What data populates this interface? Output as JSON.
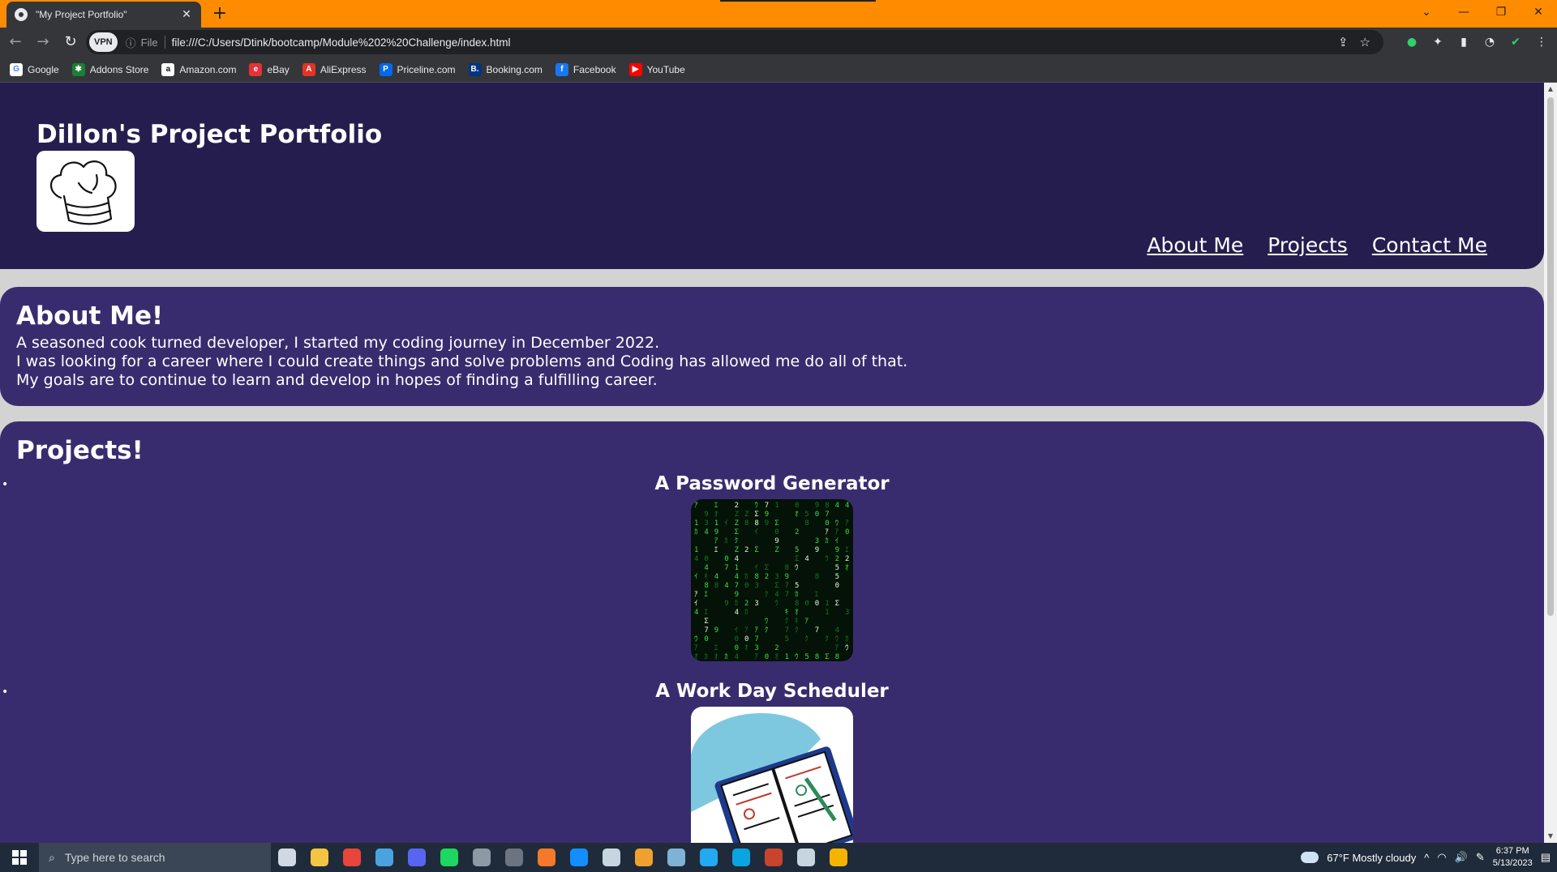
{
  "browser": {
    "tab_title": "\"My Project Portfolio\"",
    "tab_close": "✕",
    "new_tab": "+",
    "window_controls": [
      "⌄",
      "—",
      "❐",
      "✕"
    ],
    "nav": {
      "back": "←",
      "forward": "→",
      "reload": "↻"
    },
    "vpn_label": "VPN",
    "info_icon": "ⓘ",
    "file_label": "File",
    "url": "file:///C:/Users/Dtink/bootcamp/Module%202%20Challenge/index.html",
    "omnibox_icons": {
      "share": "⇪",
      "star": "☆"
    },
    "toolbar_icons": {
      "ext1": "●",
      "puzzle": "✦",
      "sidebar": "▮",
      "profile": "◔",
      "shield": "✔",
      "menu": "⋮"
    }
  },
  "bookmarks": [
    {
      "label": "Google",
      "icon": "G",
      "color": "#ffffff",
      "fg": "#4285f4"
    },
    {
      "label": "Addons Store",
      "icon": "✱",
      "color": "#1a7f37",
      "fg": "#ffffff"
    },
    {
      "label": "Amazon.com",
      "icon": "a",
      "color": "#ffffff",
      "fg": "#111111"
    },
    {
      "label": "eBay",
      "icon": "e",
      "color": "#e53238",
      "fg": "#ffffff"
    },
    {
      "label": "AliExpress",
      "icon": "A",
      "color": "#e43225",
      "fg": "#ffffff"
    },
    {
      "label": "Priceline.com",
      "icon": "P",
      "color": "#0068ef",
      "fg": "#ffffff"
    },
    {
      "label": "Booking.com",
      "icon": "B.",
      "color": "#003580",
      "fg": "#ffffff"
    },
    {
      "label": "Facebook",
      "icon": "f",
      "color": "#1877f2",
      "fg": "#ffffff"
    },
    {
      "label": "YouTube",
      "icon": "▶",
      "color": "#ff0000",
      "fg": "#ffffff"
    }
  ],
  "page": {
    "site_title": "Dillon's Project Portfolio",
    "nav": {
      "about": "About Me",
      "projects": "Projects",
      "contact": "Contact Me"
    },
    "about": {
      "heading": "About Me!",
      "lines": [
        "A seasoned cook turned developer, I started my coding journey in December 2022.",
        "I was looking for a career where I could create things and solve problems and Coding has allowed me do all of that.",
        "My goals are to continue to learn and develop in hopes of finding a fulfilling career."
      ]
    },
    "projects": {
      "heading": "Projects!",
      "bullet": "•",
      "items": [
        {
          "title": "A Password Generator",
          "image": "matrix-code-image"
        },
        {
          "title": "A Work Day Scheduler",
          "image": "planner-book-image"
        }
      ]
    }
  },
  "taskbar": {
    "search_placeholder": "Type here to search",
    "weather": "67°F  Mostly cloudy",
    "time": "6:37 PM",
    "date": "5/13/2023",
    "tray_icons": {
      "chevron": "^",
      "wifi": "◠",
      "volume": "🔊",
      "pen": "✎",
      "notifications": "▤"
    },
    "apps": [
      {
        "name": "task-view",
        "color": "#cfd8e3"
      },
      {
        "name": "file-explorer",
        "color": "#f6c445"
      },
      {
        "name": "chrome",
        "color": "#e8453c"
      },
      {
        "name": "control-panel",
        "color": "#4aa3df"
      },
      {
        "name": "discord",
        "color": "#5865f2"
      },
      {
        "name": "spotify",
        "color": "#1ed760"
      },
      {
        "name": "calculator",
        "color": "#8d99a6"
      },
      {
        "name": "app-generic",
        "color": "#6b7480"
      },
      {
        "name": "blender",
        "color": "#f5792a"
      },
      {
        "name": "battle-net",
        "color": "#148eff"
      },
      {
        "name": "steam",
        "color": "#c7d5e0"
      },
      {
        "name": "sourcetree",
        "color": "#f0a030"
      },
      {
        "name": "notepad",
        "color": "#7fb3d5"
      },
      {
        "name": "vscode",
        "color": "#23a8f2"
      },
      {
        "name": "c-app",
        "color": "#0aa5e0"
      },
      {
        "name": "red-app",
        "color": "#c8442c"
      },
      {
        "name": "steam-2",
        "color": "#c7d5e0"
      },
      {
        "name": "chrome-canary",
        "color": "#f4b400"
      }
    ]
  }
}
